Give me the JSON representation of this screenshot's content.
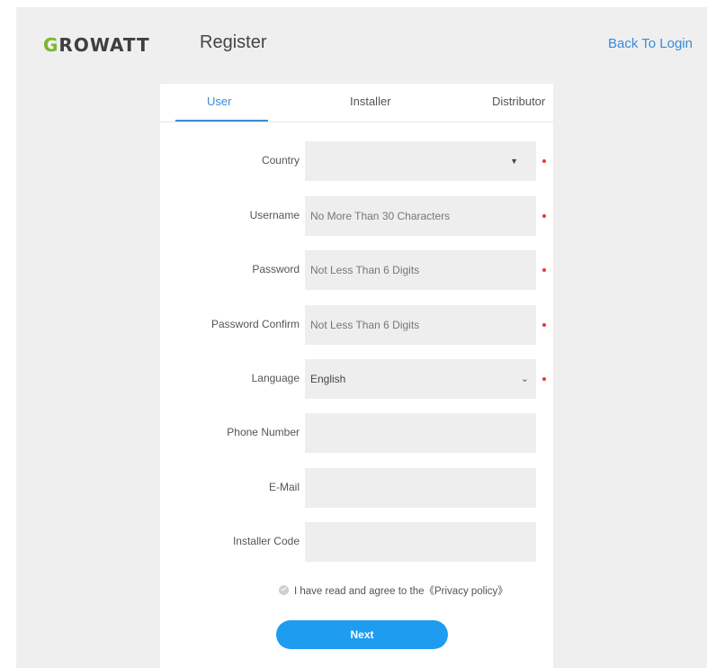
{
  "header": {
    "logo_first": "G",
    "logo_rest": "ROWATT",
    "title": "Register",
    "back_link": "Back To Login"
  },
  "tabs": [
    {
      "label": "User",
      "active": true
    },
    {
      "label": "Installer",
      "active": false
    },
    {
      "label": "Distributor",
      "active": false
    }
  ],
  "form": {
    "country": {
      "label": "Country",
      "value": "",
      "required": true
    },
    "username": {
      "label": "Username",
      "placeholder": "No More Than 30 Characters",
      "required": true
    },
    "password": {
      "label": "Password",
      "placeholder": "Not Less Than 6 Digits",
      "required": true
    },
    "password_confirm": {
      "label": "Password Confirm",
      "placeholder": "Not Less Than 6 Digits",
      "required": true
    },
    "language": {
      "label": "Language",
      "value": "English",
      "required": true
    },
    "phone": {
      "label": "Phone Number",
      "value": ""
    },
    "email": {
      "label": "E-Mail",
      "value": ""
    },
    "installer_code": {
      "label": "Installer Code",
      "value": ""
    }
  },
  "agree": {
    "text": "I have read and agree to the",
    "link": "《Privacy policy》",
    "checked": true
  },
  "next_label": "Next",
  "colors": {
    "accent": "#3a8bd8",
    "button": "#1e9cf0",
    "required": "#e23b3b",
    "logo_green": "#78b82a",
    "background": "#efefef",
    "field": "#eeeeee"
  },
  "icons": {
    "country_dropdown": "caret-down-icon",
    "language_dropdown": "chevron-down-icon",
    "agree_checkbox": "check-circle-icon"
  }
}
